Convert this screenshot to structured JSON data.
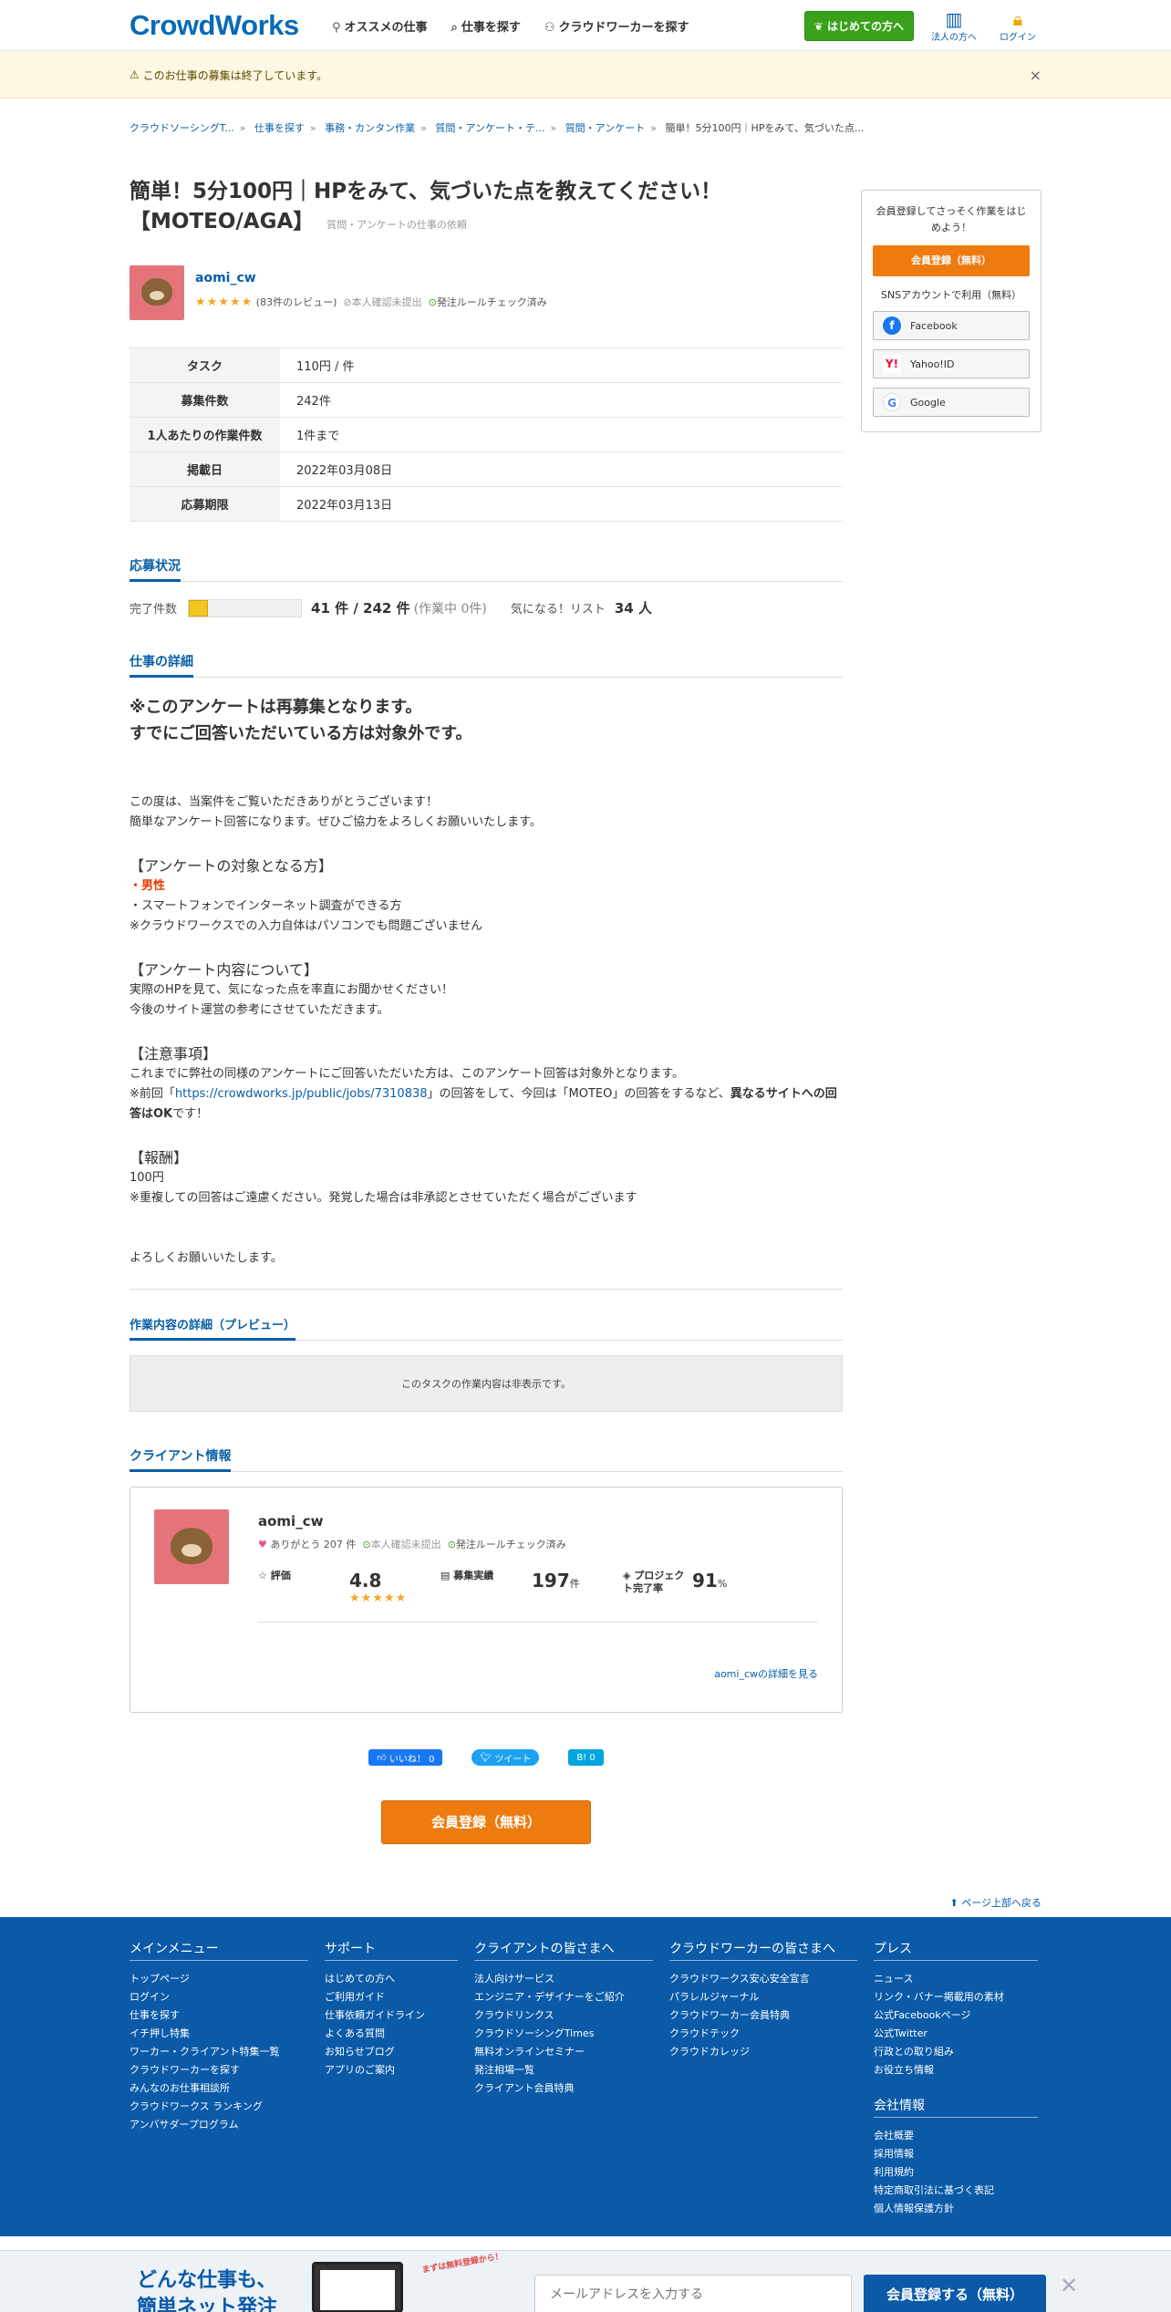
{
  "header": {
    "logo": "CrowdWorks",
    "nav": [
      "オススメの仕事",
      "仕事を探す",
      "クラウドワーカーを探す"
    ],
    "first_button": "はじめての方へ",
    "corp_label": "法人の方へ",
    "login_label": "ログイン"
  },
  "notice": {
    "text": "このお仕事の募集は終了しています。",
    "close": "×"
  },
  "breadcrumb": [
    "クラウドソーシングT...",
    "仕事を探す",
    "事務・カンタン作業",
    "質問・アンケート・テ...",
    "質問・アンケート",
    "簡単！5分100円｜HPをみて、気づいた点..."
  ],
  "job": {
    "title": "簡単！5分100円｜HPをみて、気づいた点を教えてください！【MOTEO/AGA】",
    "category_note": "質問・アンケートの仕事の依頼",
    "client_name": "aomi_cw",
    "stars": "★★★★★",
    "reviews": "(83件のレビュー)",
    "identity": "本人確認未提出",
    "rule_check": "発注ルールチェック済み",
    "info": [
      {
        "label": "タスク",
        "value": "110円 / 件"
      },
      {
        "label": "募集件数",
        "value": "242件"
      },
      {
        "label": "1人あたりの作業件数",
        "value": "1件まで"
      },
      {
        "label": "掲載日",
        "value": "2022年03月08日"
      },
      {
        "label": "応募期限",
        "value": "2022年03月13日"
      }
    ]
  },
  "status": {
    "heading": "応募状況",
    "done_label": "完了件数",
    "progress": 0.17,
    "count": "41 件 / 242 件",
    "in_progress": "(作業中 0件)",
    "watch_label": "気になる！リスト",
    "watch_count": "34 人"
  },
  "detail": {
    "heading": "仕事の詳細",
    "lead1": "※このアンケートは再募集となります。",
    "lead2": "すでにご回答いただいている方は対象外です。",
    "p1": "この度は、当案件をご覧いただきありがとうございます！",
    "p2": "簡単なアンケート回答になります。ぜひご協力をよろしくお願いいたします。",
    "h1": "【アンケートの対象となる方】",
    "male": "・男性",
    "t1": "・スマートフォンでインターネット調査ができる方",
    "t2": "※クラウドワークスでの入力自体はパソコンでも問題ございません",
    "h2": "【アンケート内容について】",
    "c1": "実際のHPを見て、気になった点を率直にお聞かせください！",
    "c2": "今後のサイト運営の参考にさせていただきます。",
    "h3": "【注意事項】",
    "n1": "これまでに弊社の同様のアンケートにご回答いただいた方は、このアンケート回答は対象外となります。",
    "n2a": "※前回「",
    "n2link": "https://crowdworks.jp/public/jobs/7310838",
    "n2b": "」の回答をして、今回は「MOTEO」の回答をするなど、",
    "n2bold": "異なるサイトへの回答はOK",
    "n2c": "です！",
    "h4": "【報酬】",
    "r1": "100円",
    "r2": "※重複しての回答はご遠慮ください。発覚した場合は非承認とさせていただく場合がございます",
    "closing": "よろしくお願いいたします。"
  },
  "preview": {
    "heading": "作業内容の詳細（プレビュー）",
    "text": "このタスクの作業内容は非表示です。"
  },
  "client_info": {
    "heading": "クライアント情報",
    "name": "aomi_cw",
    "thanks": "ありがとう 207 件",
    "identity": "本人確認未提出",
    "rule_check": "発注ルールチェック済み",
    "rating_label": "評価",
    "rating": "4.8",
    "stars": "★★★★★",
    "orders_label": "募集実績",
    "orders": "197",
    "orders_unit": "件",
    "complete_label": "プロジェクト完了率",
    "complete": "91",
    "complete_unit": "%",
    "more": "aomi_cwの詳細を見る"
  },
  "social": {
    "like": "いいね！ 0",
    "tweet": "ツイート",
    "hatena": "B! 0"
  },
  "cta": "会員登録（無料）",
  "totop": "ページ上部へ戻る",
  "sidebar": {
    "text": "会員登録してさっそく作業をはじめよう！",
    "register": "会員登録（無料）",
    "sns_label": "SNSアカウントで利用（無料）",
    "facebook": "Facebook",
    "yahoo": "Yahoo!ID",
    "google": "Google"
  },
  "footer": {
    "main": {
      "title": "メインメニュー",
      "items": [
        "トップページ",
        "ログイン",
        "仕事を探す",
        "イチ押し特集",
        "ワーカー・クライアント特集一覧",
        "クラウドワーカーを探す",
        "みんなのお仕事相談所",
        "クラウドワークス ランキング",
        "アンバサダープログラム"
      ]
    },
    "support": {
      "title": "サポート",
      "items": [
        "はじめての方へ",
        "ご利用ガイド",
        "仕事依頼ガイドライン",
        "よくある質問",
        "お知らせブログ",
        "アプリのご案内"
      ]
    },
    "client": {
      "title": "クライアントの皆さまへ",
      "items": [
        "法人向けサービス",
        "エンジニア・デザイナーをご紹介",
        "クラウドリンクス",
        "クラウドソーシングTimes",
        "無料オンラインセミナー",
        "発注相場一覧",
        "クライアント会員特典"
      ]
    },
    "worker": {
      "title": "クラウドワーカーの皆さまへ",
      "items": [
        "クラウドワークス安心安全宣言",
        "パラレルジャーナル",
        "クラウドワーカー会員特典",
        "クラウドテック",
        "クラウドカレッジ"
      ]
    },
    "press": {
      "title": "プレス",
      "items": [
        "ニュース",
        "リンク・バナー掲載用の素材",
        "公式Facebookページ",
        "公式Twitter",
        "行政との取り組み",
        "お役立ち情報"
      ]
    },
    "company": {
      "title": "会社情報",
      "items": [
        "会社概要",
        "採用情報",
        "利用規約",
        "特定商取引法に基づく表記",
        "個人情報保護方針"
      ]
    }
  },
  "bottom": {
    "slogan1": "どんな仕事も、",
    "slogan2": "簡単ネット発注",
    "tag": "まずは無料登録から！",
    "email_placeholder": "メールアドレスを入力する",
    "register": "会員登録する（無料）",
    "close": "✕"
  }
}
